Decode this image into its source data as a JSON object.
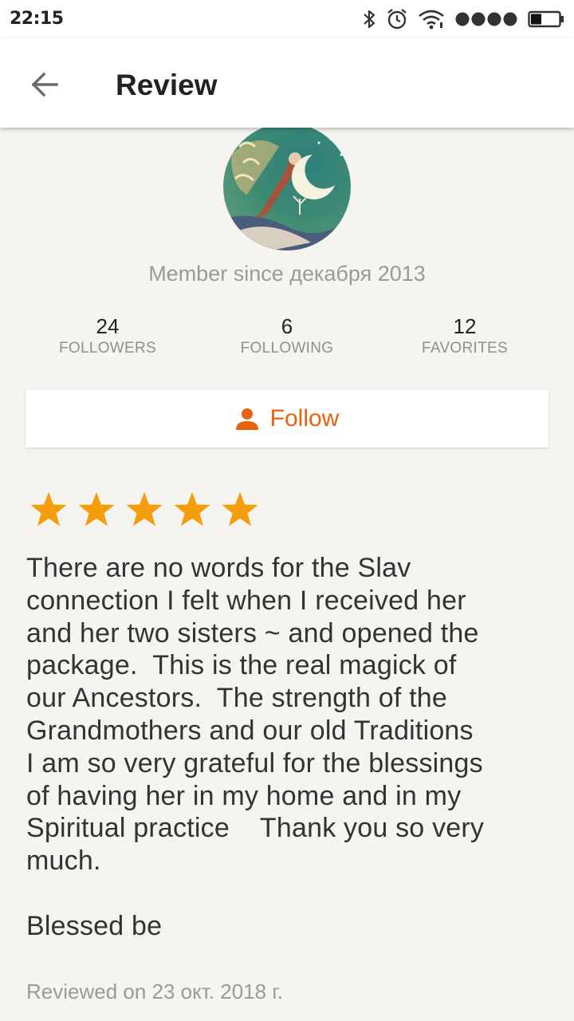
{
  "status_bar": {
    "time": "22:15",
    "icons": [
      "bluetooth-icon",
      "alarm-icon",
      "wifi-icon",
      "signal-dots-icon",
      "battery-icon"
    ]
  },
  "app_bar": {
    "back_icon": "arrow-left-icon",
    "title": "Review"
  },
  "profile": {
    "member_since": "Member since декабря 2013",
    "stats": [
      {
        "count": "24",
        "label": "FOLLOWERS"
      },
      {
        "count": "6",
        "label": "FOLLOWING"
      },
      {
        "count": "12",
        "label": "FAVORITES"
      }
    ],
    "follow_label": "Follow",
    "follow_icon": "person-icon"
  },
  "review": {
    "rating": 5,
    "rating_max": 5,
    "text": "There are no words for the Slav\nconnection I felt when I received her\nand her two sisters ~ and opened the\npackage.  This is the real magick of\nour Ancestors.  The strength of the\nGrandmothers and our old Traditions\nI am so very grateful for the blessings\nof having her in my home and in my\nSpiritual practice    Thank you so very\nmuch.\n\nBlessed be",
    "date": "Reviewed on 23 окт. 2018 г."
  },
  "colors": {
    "accent": "#e8620e",
    "star": "#f59e0b",
    "background": "#f5f4f0"
  }
}
